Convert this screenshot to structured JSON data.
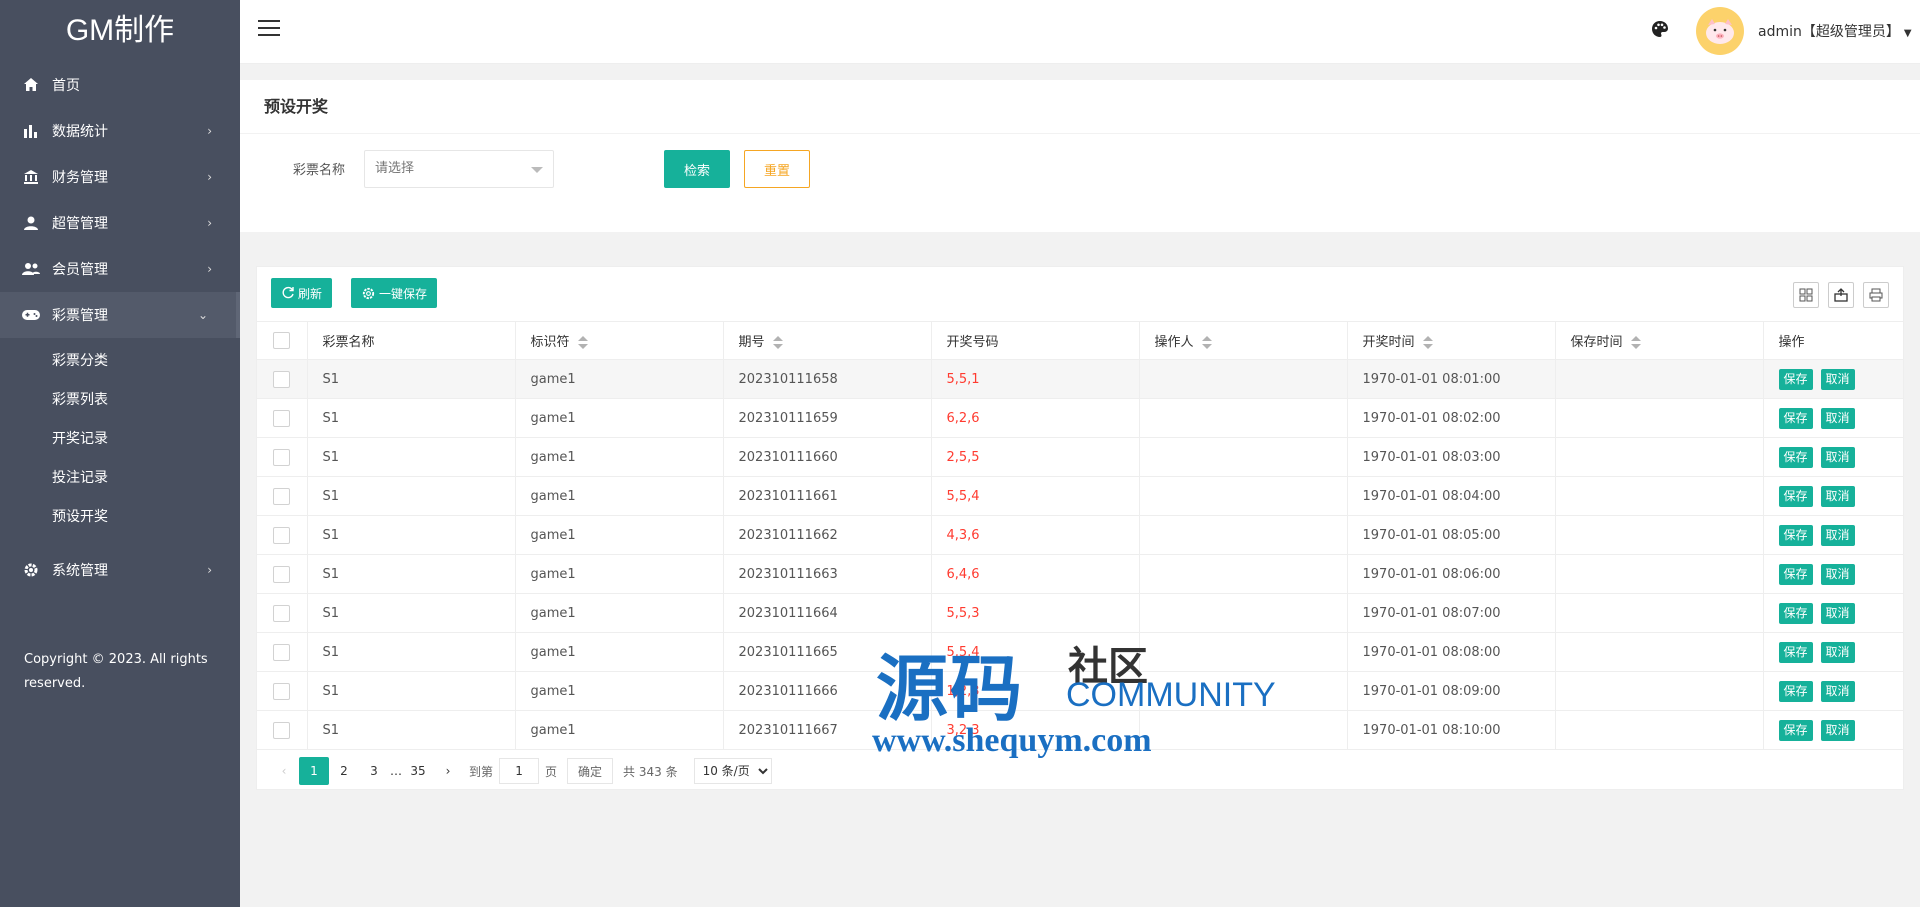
{
  "sidebar": {
    "logo": "GM制作",
    "items": [
      {
        "label": "首页",
        "icon": "home-icon"
      },
      {
        "label": "数据统计",
        "icon": "bar-chart-icon"
      },
      {
        "label": "财务管理",
        "icon": "bank-icon"
      },
      {
        "label": "超管管理",
        "icon": "user-icon"
      },
      {
        "label": "会员管理",
        "icon": "users-icon"
      },
      {
        "label": "彩票管理",
        "icon": "gamepad-icon"
      },
      {
        "label": "系统管理",
        "icon": "gear-icon"
      }
    ],
    "submenu": [
      "彩票分类",
      "彩票列表",
      "开奖记录",
      "投注记录",
      "预设开奖"
    ],
    "copyright": "Copyright © 2023. All rights reserved."
  },
  "header": {
    "user": "admin【超级管理员】"
  },
  "search": {
    "title": "预设开奖",
    "label": "彩票名称",
    "placeholder": "请选择",
    "search_btn": "检索",
    "reset_btn": "重置"
  },
  "toolbar": {
    "refresh": "刷新",
    "save_all": "一键保存"
  },
  "table": {
    "columns": [
      "彩票名称",
      "标识符",
      "期号",
      "开奖号码",
      "操作人",
      "开奖时间",
      "保存时间",
      "操作"
    ],
    "rows": [
      {
        "name": "S1",
        "code": "game1",
        "period": "202310111658",
        "numbers": "5,5,1",
        "operator": "",
        "draw_time": "1970-01-01 08:01:00",
        "save_time": ""
      },
      {
        "name": "S1",
        "code": "game1",
        "period": "202310111659",
        "numbers": "6,2,6",
        "operator": "",
        "draw_time": "1970-01-01 08:02:00",
        "save_time": ""
      },
      {
        "name": "S1",
        "code": "game1",
        "period": "202310111660",
        "numbers": "2,5,5",
        "operator": "",
        "draw_time": "1970-01-01 08:03:00",
        "save_time": ""
      },
      {
        "name": "S1",
        "code": "game1",
        "period": "202310111661",
        "numbers": "5,5,4",
        "operator": "",
        "draw_time": "1970-01-01 08:04:00",
        "save_time": ""
      },
      {
        "name": "S1",
        "code": "game1",
        "period": "202310111662",
        "numbers": "4,3,6",
        "operator": "",
        "draw_time": "1970-01-01 08:05:00",
        "save_time": ""
      },
      {
        "name": "S1",
        "code": "game1",
        "period": "202310111663",
        "numbers": "6,4,6",
        "operator": "",
        "draw_time": "1970-01-01 08:06:00",
        "save_time": ""
      },
      {
        "name": "S1",
        "code": "game1",
        "period": "202310111664",
        "numbers": "5,5,3",
        "operator": "",
        "draw_time": "1970-01-01 08:07:00",
        "save_time": ""
      },
      {
        "name": "S1",
        "code": "game1",
        "period": "202310111665",
        "numbers": "5,5,4",
        "operator": "",
        "draw_time": "1970-01-01 08:08:00",
        "save_time": ""
      },
      {
        "name": "S1",
        "code": "game1",
        "period": "202310111666",
        "numbers": "1,2,3",
        "operator": "",
        "draw_time": "1970-01-01 08:09:00",
        "save_time": ""
      },
      {
        "name": "S1",
        "code": "game1",
        "period": "202310111667",
        "numbers": "3,2,3",
        "operator": "",
        "draw_time": "1970-01-01 08:10:00",
        "save_time": ""
      }
    ],
    "save_label": "保存",
    "cancel_label": "取消"
  },
  "pager": {
    "pages": [
      "1",
      "2",
      "3",
      "…",
      "35"
    ],
    "goto_label": "到第",
    "goto_value": "1",
    "page_unit": "页",
    "confirm": "确定",
    "total": "共 343 条",
    "limit": "10 条/页"
  },
  "watermark": {
    "big": "源码",
    "small": "社区",
    "community": "COMMUNITY",
    "url": "www.shequym.com"
  },
  "colors": {
    "sidebar_bg": "#484f5f",
    "accent": "#16b19a",
    "reset_orange": "#f5a623",
    "numbers_red": "#ff3b30"
  }
}
